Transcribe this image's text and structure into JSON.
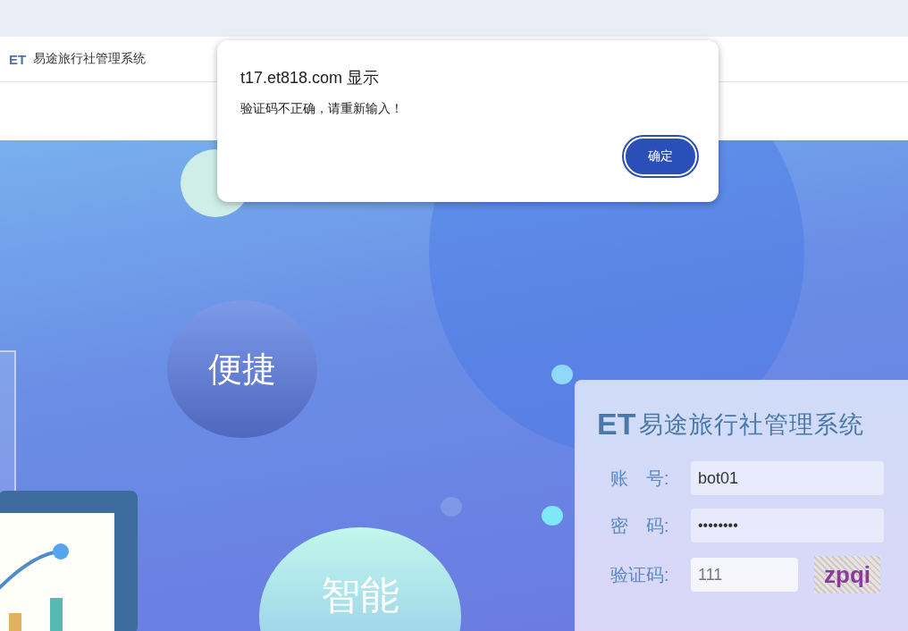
{
  "browser_tab": {
    "logo_mark": "ET",
    "title": "易途旅行社管理系统"
  },
  "dialog": {
    "title": "t17.et818.com 显示",
    "message": "验证码不正确，请重新输入！",
    "button": "确定"
  },
  "hero": {
    "bubbles": [
      {
        "label": "便捷"
      },
      {
        "label": "智能"
      }
    ]
  },
  "login": {
    "logo_mark": "ET",
    "logo_text": "易途旅行社管理系统",
    "fields": [
      {
        "kind": "text",
        "label": "账　号:",
        "value": "bot01"
      },
      {
        "kind": "password",
        "label": "密　码:",
        "value": "••••••••"
      },
      {
        "kind": "captcha",
        "label": "验证码:",
        "value": "111",
        "captcha": "zpqi"
      }
    ]
  }
}
